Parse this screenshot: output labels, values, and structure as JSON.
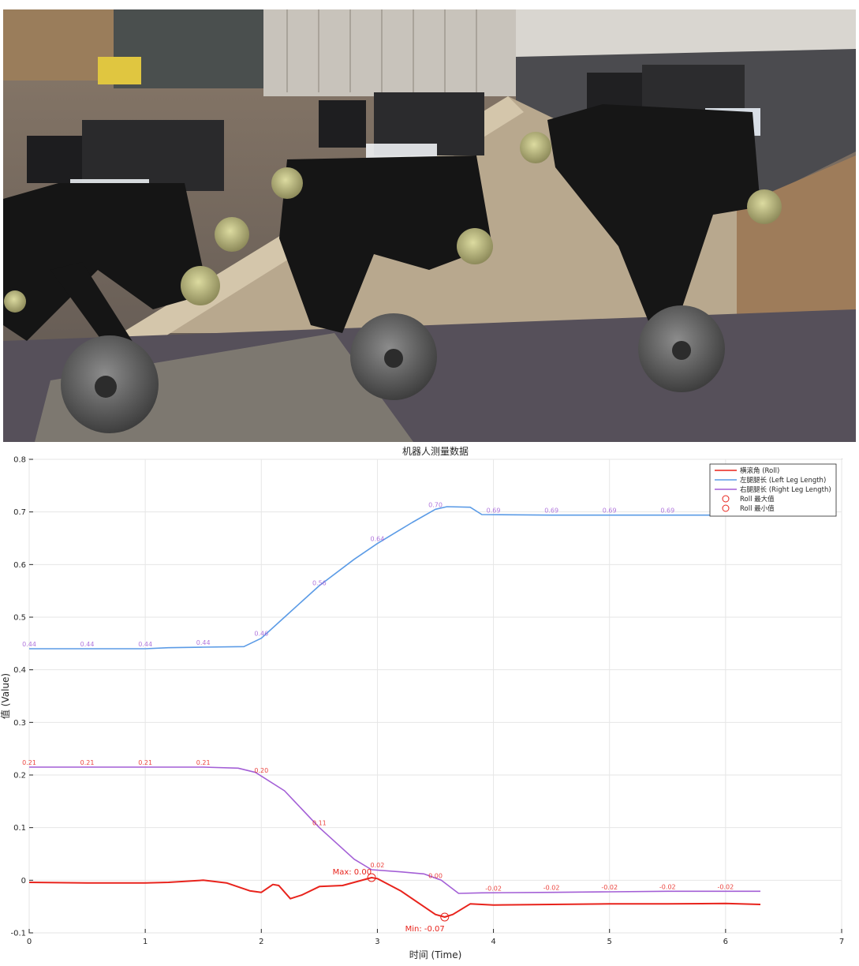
{
  "chart_data": {
    "type": "line",
    "title": "机器人测量数据",
    "xlabel": "时间 (Time)",
    "ylabel": "值 (Value)",
    "xlim": [
      0,
      7
    ],
    "ylim": [
      -0.1,
      0.8
    ],
    "grid": true,
    "legend_position": "top-right",
    "x_ticks": [
      "0",
      "1",
      "2",
      "3",
      "4",
      "5",
      "6",
      "7"
    ],
    "y_ticks": [
      "-0.1",
      "0",
      "0.1",
      "0.2",
      "0.3",
      "0.4",
      "0.5",
      "0.6",
      "0.7",
      "0.8"
    ],
    "legend": [
      {
        "label": "横滚角 (Roll)",
        "marker": "line",
        "color": "#e8231c"
      },
      {
        "label": "左腿腿长 (Left Leg Length)",
        "marker": "line",
        "color": "#5b9be6"
      },
      {
        "label": "右腿腿长 (Right Leg Length)",
        "marker": "line",
        "color": "#a35fd6"
      },
      {
        "label": "Roll 最大值",
        "marker": "circle",
        "color": "#e8231c"
      },
      {
        "label": "Roll 最小值",
        "marker": "circle",
        "color": "#e8231c"
      }
    ],
    "series": [
      {
        "name": "左腿腿长 (Left Leg Length)",
        "color": "#5b9be6",
        "x": [
          0,
          0.5,
          1.0,
          1.2,
          1.5,
          1.85,
          2.0,
          2.2,
          2.5,
          2.8,
          3.0,
          3.3,
          3.5,
          3.6,
          3.8,
          3.9,
          4.5,
          5.0,
          5.5,
          6.0,
          6.3
        ],
        "y": [
          0.44,
          0.44,
          0.44,
          0.442,
          0.443,
          0.444,
          0.46,
          0.5,
          0.56,
          0.61,
          0.64,
          0.68,
          0.705,
          0.71,
          0.709,
          0.695,
          0.694,
          0.694,
          0.694,
          0.694,
          0.693
        ]
      },
      {
        "name": "右腿腿长 (Right Leg Length)",
        "color": "#a35fd6",
        "x": [
          0,
          0.5,
          1.0,
          1.5,
          1.8,
          1.95,
          2.2,
          2.5,
          2.8,
          2.95,
          3.2,
          3.4,
          3.55,
          3.7,
          3.9,
          4.5,
          5.0,
          5.5,
          6.0,
          6.3
        ],
        "y": [
          0.215,
          0.215,
          0.215,
          0.215,
          0.213,
          0.205,
          0.17,
          0.1,
          0.04,
          0.02,
          0.016,
          0.012,
          0.0,
          -0.025,
          -0.024,
          -0.023,
          -0.022,
          -0.021,
          -0.021,
          -0.021
        ]
      },
      {
        "name": "横滚角 (Roll)",
        "color": "#e8231c",
        "x": [
          0,
          0.5,
          1.0,
          1.2,
          1.5,
          1.7,
          1.9,
          2.0,
          2.1,
          2.15,
          2.25,
          2.35,
          2.5,
          2.7,
          2.95,
          3.0,
          3.2,
          3.4,
          3.5,
          3.58,
          3.65,
          3.8,
          4.0,
          4.5,
          5.0,
          5.5,
          6.0,
          6.3
        ],
        "y": [
          -0.004,
          -0.005,
          -0.005,
          -0.004,
          0.0,
          -0.005,
          -0.02,
          -0.023,
          -0.008,
          -0.01,
          -0.035,
          -0.028,
          -0.012,
          -0.01,
          0.005,
          0.003,
          -0.02,
          -0.05,
          -0.065,
          -0.07,
          -0.065,
          -0.045,
          -0.047,
          -0.046,
          -0.045,
          -0.045,
          -0.044,
          -0.046
        ]
      }
    ],
    "data_labels": [
      {
        "x": 0.0,
        "y": 0.44,
        "text": "0.44",
        "series": 1
      },
      {
        "x": 0.5,
        "y": 0.44,
        "text": "0.44",
        "series": 1
      },
      {
        "x": 1.0,
        "y": 0.44,
        "text": "0.44",
        "series": 1
      },
      {
        "x": 1.5,
        "y": 0.443,
        "text": "0.44",
        "series": 1
      },
      {
        "x": 2.0,
        "y": 0.46,
        "text": "0.46",
        "series": 1
      },
      {
        "x": 2.5,
        "y": 0.556,
        "text": "0.56",
        "series": 1
      },
      {
        "x": 3.0,
        "y": 0.64,
        "text": "0.64",
        "series": 1
      },
      {
        "x": 3.5,
        "y": 0.705,
        "text": "0.70",
        "series": 1
      },
      {
        "x": 4.0,
        "y": 0.694,
        "text": "0.69",
        "series": 1
      },
      {
        "x": 4.5,
        "y": 0.694,
        "text": "0.69",
        "series": 1
      },
      {
        "x": 5.0,
        "y": 0.694,
        "text": "0.69",
        "series": 1
      },
      {
        "x": 5.5,
        "y": 0.694,
        "text": "0.69",
        "series": 1
      },
      {
        "x": 0.0,
        "y": 0.215,
        "text": "0.21",
        "series": 2
      },
      {
        "x": 0.5,
        "y": 0.215,
        "text": "0.21",
        "series": 2
      },
      {
        "x": 1.0,
        "y": 0.215,
        "text": "0.21",
        "series": 2
      },
      {
        "x": 1.5,
        "y": 0.215,
        "text": "0.21",
        "series": 2
      },
      {
        "x": 2.0,
        "y": 0.2,
        "text": "0.20",
        "series": 2
      },
      {
        "x": 2.5,
        "y": 0.1,
        "text": "0.11",
        "series": 2
      },
      {
        "x": 3.0,
        "y": 0.02,
        "text": "0.02",
        "series": 2
      },
      {
        "x": 3.5,
        "y": 0.0,
        "text": "0.00",
        "series": 2
      },
      {
        "x": 4.0,
        "y": -0.024,
        "text": "-0.02",
        "series": 2
      },
      {
        "x": 4.5,
        "y": -0.023,
        "text": "-0.02",
        "series": 2
      },
      {
        "x": 5.0,
        "y": -0.022,
        "text": "-0.02",
        "series": 2
      },
      {
        "x": 5.5,
        "y": -0.021,
        "text": "-0.02",
        "series": 2
      },
      {
        "x": 6.0,
        "y": -0.021,
        "text": "-0.02",
        "series": 2
      }
    ],
    "annotations": [
      {
        "x": 2.95,
        "y": 0.005,
        "text": "Max: 0.00",
        "kind": "max"
      },
      {
        "x": 3.58,
        "y": -0.07,
        "text": "Min: -0.07",
        "kind": "min"
      }
    ]
  }
}
